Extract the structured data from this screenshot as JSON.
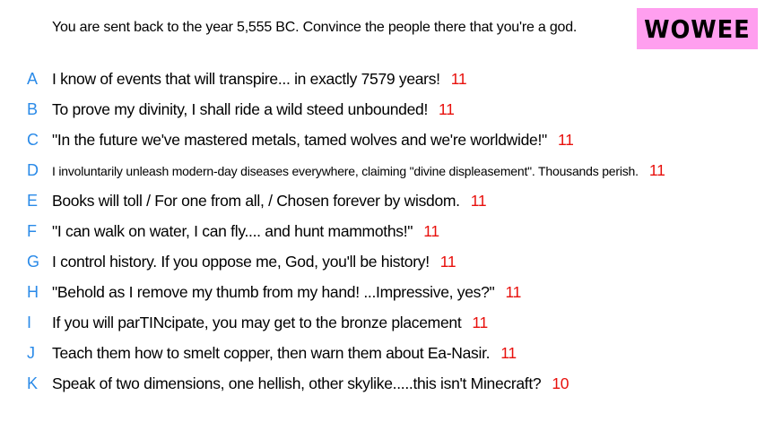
{
  "prompt": "You are sent back to the year 5,555 BC. Convince the people there that you're a god.",
  "badge": "WOWEE",
  "colors": {
    "letter": "#2a8ae8",
    "score": "#e8100c",
    "badge_bg": "#ff9fef"
  },
  "answers": [
    {
      "letter": "A",
      "text": "I know of events that will transpire... in exactly 7579 years!",
      "score": "11"
    },
    {
      "letter": "B",
      "text": "To prove my divinity, I shall ride a wild steed unbounded!",
      "score": "11"
    },
    {
      "letter": "C",
      "text": "\"In the future we've mastered metals, tamed wolves and we're worldwide!\"",
      "score": "11"
    },
    {
      "letter": "D",
      "text": "I involuntarily unleash modern-day diseases everywhere, claiming \"divine displeasement\". Thousands perish.",
      "score": "11"
    },
    {
      "letter": "E",
      "text": "Books will toll / For one from all, / Chosen forever by wisdom.",
      "score": "11"
    },
    {
      "letter": "F",
      "text": "\"I can walk on water, I can fly.... and hunt mammoths!\"",
      "score": "11"
    },
    {
      "letter": "G",
      "text": "I control history. If you oppose me, God, you'll be history!",
      "score": "11"
    },
    {
      "letter": "H",
      "text": "\"Behold as I remove my thumb from my hand! ...Impressive, yes?\"",
      "score": "11"
    },
    {
      "letter": "I",
      "text": "If you will parTINcipate, you may get to the bronze placement",
      "score": "11"
    },
    {
      "letter": "J",
      "text": "Teach them how to smelt copper, then warn them about Ea-Nasir.",
      "score": "11"
    },
    {
      "letter": "K",
      "text": "Speak of two dimensions, one hellish, other skylike.....this isn't Minecraft?",
      "score": "10"
    }
  ]
}
